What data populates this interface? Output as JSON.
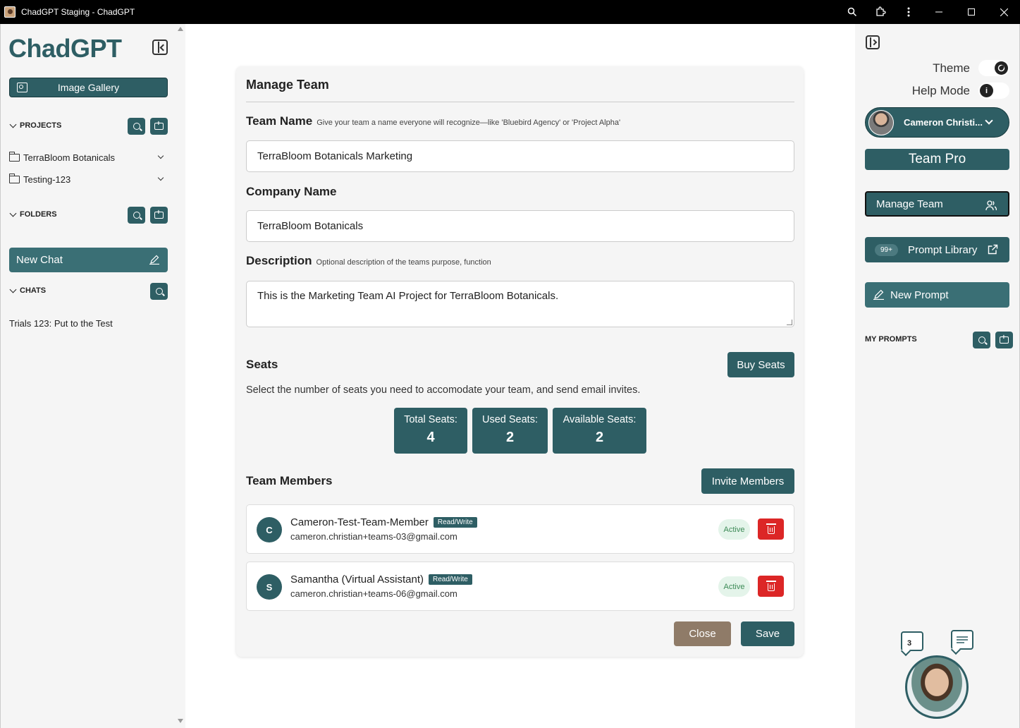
{
  "window": {
    "title": "ChadGPT Staging - ChadGPT"
  },
  "sidebar": {
    "logo": "ChadGPT",
    "image_gallery": "Image Gallery",
    "projects_header": "PROJECTS",
    "projects": [
      {
        "label": "TerraBloom Botanicals"
      },
      {
        "label": "Testing-123"
      }
    ],
    "folders_header": "FOLDERS",
    "new_chat": "New Chat",
    "chats_header": "CHATS",
    "chats": [
      {
        "label": "Trials 123: Put to the Test"
      }
    ]
  },
  "manage_team": {
    "title": "Manage Team",
    "team_name_label": "Team Name",
    "team_name_hint": "Give your team a name everyone will recognize—like 'Bluebird Agency' or 'Project Alpha'",
    "team_name_value": "TerraBloom Botanicals Marketing",
    "company_name_label": "Company Name",
    "company_name_value": "TerraBloom Botanicals",
    "description_label": "Description",
    "description_hint": "Optional description of the teams purpose, function",
    "description_value": "This is the Marketing Team AI Project for TerraBloom Botanicals.",
    "seats_label": "Seats",
    "buy_seats": "Buy Seats",
    "seats_desc": "Select the number of seats you need to accomodate your team, and send email invites.",
    "seat_stats": [
      {
        "label": "Total Seats:",
        "value": "4"
      },
      {
        "label": "Used Seats:",
        "value": "2"
      },
      {
        "label": "Available Seats:",
        "value": "2"
      }
    ],
    "members_label": "Team Members",
    "invite_members": "Invite Members",
    "members": [
      {
        "initial": "C",
        "name": "Cameron-Test-Team-Member",
        "role": "Read/Write",
        "email": "cameron.christian+teams-03@gmail.com",
        "status": "Active"
      },
      {
        "initial": "S",
        "name": "Samantha (Virtual Assistant)",
        "role": "Read/Write",
        "email": "cameron.christian+teams-06@gmail.com",
        "status": "Active"
      }
    ],
    "close": "Close",
    "save": "Save"
  },
  "right_panel": {
    "theme_label": "Theme",
    "help_mode_label": "Help Mode",
    "user_name": "Cameron Christi...",
    "plan": "Team Pro",
    "manage_team": "Manage Team",
    "prompt_badge": "99+",
    "prompt_library": "Prompt Library",
    "new_prompt": "New Prompt",
    "my_prompts": "MY PROMPTS",
    "assistant_count": "3"
  },
  "colors": {
    "accent": "#2e5e64",
    "danger": "#dc2626",
    "close": "#8f7b68"
  }
}
